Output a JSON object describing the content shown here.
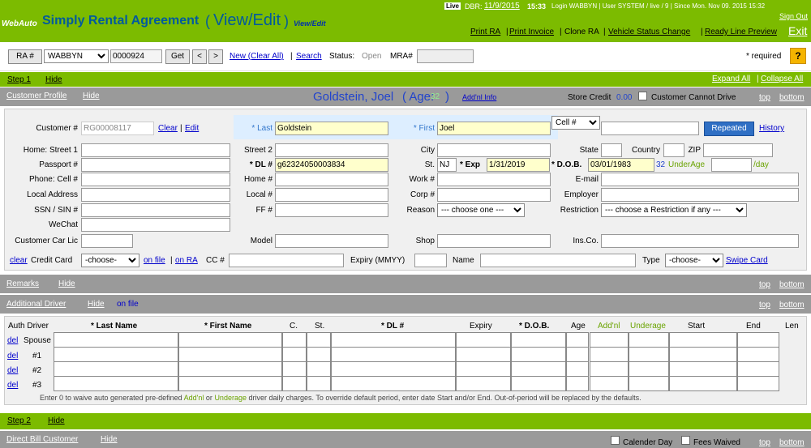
{
  "header": {
    "logo": "WebAuto",
    "title": "Simply Rental Agreement",
    "paren_open": "(",
    "mode": "View/Edit",
    "paren_close": ")",
    "mode_small": "View/Edit",
    "live_badge": "Live",
    "dbr_label": "DBR:",
    "date": "11/9/2015",
    "time": "15:33",
    "login_text": "Login WABBYN | User SYSTEM / live / 9 | Since Mon. Nov 09. 2015 15:32",
    "sign_out": "Sign Out",
    "links": [
      "Print RA",
      "Print Invoice",
      "Clone RA",
      "Vehicle Status Change",
      "Ready Line Preview"
    ],
    "exit": "Exit"
  },
  "toolbar": {
    "ra_button": "RA #",
    "location_select": "WABBYN",
    "ra_number": "0000924",
    "get_button": "Get",
    "prev": "<",
    "next": ">",
    "new_clear": "New (Clear All)",
    "search": "Search",
    "status_label": "Status:",
    "status_value": "Open",
    "mra_label": "MRA#",
    "required_note": "* required",
    "help": "?"
  },
  "step1": {
    "label": "Step 1",
    "hide": "Hide",
    "expand_all": "Expand All",
    "collapse_all": "Collapse All"
  },
  "profile_bar": {
    "label": "Customer Profile",
    "hide": "Hide",
    "customer_name": "Goldstein, Joel",
    "age_prefix": "( Age:",
    "age": "32",
    "age_suffix": ")",
    "addl_info": "Add'nl Info",
    "store_credit_label": "Store Credit",
    "store_credit_value": "0.00",
    "cannot_drive": "Customer Cannot Drive",
    "top": "top",
    "bottom": "bottom"
  },
  "customer": {
    "customer_num_label": "Customer #",
    "customer_num": "RG00008117",
    "clear": "Clear",
    "edit": "Edit",
    "last_label": "* Last",
    "last": "Goldstein",
    "first_label": "* First",
    "first": "Joel",
    "phone_type": "Cell #",
    "repeated": "Repeated",
    "history": "History",
    "home_street1": "Home: Street 1",
    "street2": "Street 2",
    "city": "City",
    "state": "State",
    "country": "Country",
    "zip": "ZIP",
    "passport": "Passport #",
    "dl_label": "* DL #",
    "dl": "g62324050003834",
    "st_label": "St.",
    "st": "NJ",
    "exp_label": "* Exp",
    "exp": "1/31/2019",
    "dob_label": "* D.O.B.",
    "dob": "03/01/1983",
    "dob_age": "32",
    "underage": "UnderAge",
    "per_day": "/day",
    "phone_cell": "Phone: Cell #",
    "home_num": "Home #",
    "work_num": "Work #",
    "email": "E-mail",
    "local_address": "Local Address",
    "local_num": "Local #",
    "corp_num": "Corp #",
    "employer": "Employer",
    "ssn": "SSN / SIN #",
    "ff_num": "FF #",
    "reason_label": "Reason",
    "reason": "--- choose one ---",
    "restriction_label": "Restriction",
    "restriction": "--- choose a Restriction if any ---",
    "wechat": "WeChat",
    "car_lic": "Customer Car Lic",
    "model": "Model",
    "shop": "Shop",
    "insco": "Ins.Co.",
    "cc_clear": "clear",
    "credit_card": "Credit Card",
    "cc_choose": "-choose-",
    "on_file": "on file",
    "on_ra": "on RA",
    "cc_num": "CC #",
    "expiry": "Expiry (MMYY)",
    "name": "Name",
    "type": "Type",
    "type_choose": "-choose-",
    "swipe": "Swipe Card"
  },
  "remarks_bar": {
    "label": "Remarks",
    "hide": "Hide",
    "top": "top",
    "bottom": "bottom"
  },
  "addl_bar": {
    "label": "Additional Driver",
    "hide": "Hide",
    "on_file": "on file",
    "top": "top",
    "bottom": "bottom"
  },
  "drivers": {
    "columns": [
      "Auth Driver",
      "* Last Name",
      "* First Name",
      "C.",
      "St.",
      "* DL #",
      "Expiry",
      "* D.O.B.",
      "Age",
      "Add'nl",
      "Underage",
      "Start",
      "End",
      "Len"
    ],
    "spouse": "Spouse",
    "rows": [
      {
        "del": "del",
        "num": "#1"
      },
      {
        "del": "del",
        "num": "#2"
      },
      {
        "del": "del",
        "num": "#3"
      }
    ],
    "del_spouse": "del",
    "note_a": "Enter 0 to waive auto generated pre-defined",
    "note_addl": "Add'nl",
    "note_or": "or",
    "note_under": "Underage",
    "note_b": "driver daily charges. To override default period, enter date Start and/or End. Out-of-period will be replaced by the defaults."
  },
  "step2": {
    "label": "Step 2",
    "hide": "Hide"
  },
  "direct_bill": {
    "label": "Direct Bill Customer",
    "hide": "Hide",
    "calendar_day": "Calender Day",
    "fees_waived": "Fees Waived",
    "top": "top",
    "bottom": "bottom"
  },
  "colors": {
    "green": "#7cbb00",
    "grey": "#9a9a9a",
    "name_blue": "#2244cc",
    "required_yellow": "#ffffcc"
  }
}
